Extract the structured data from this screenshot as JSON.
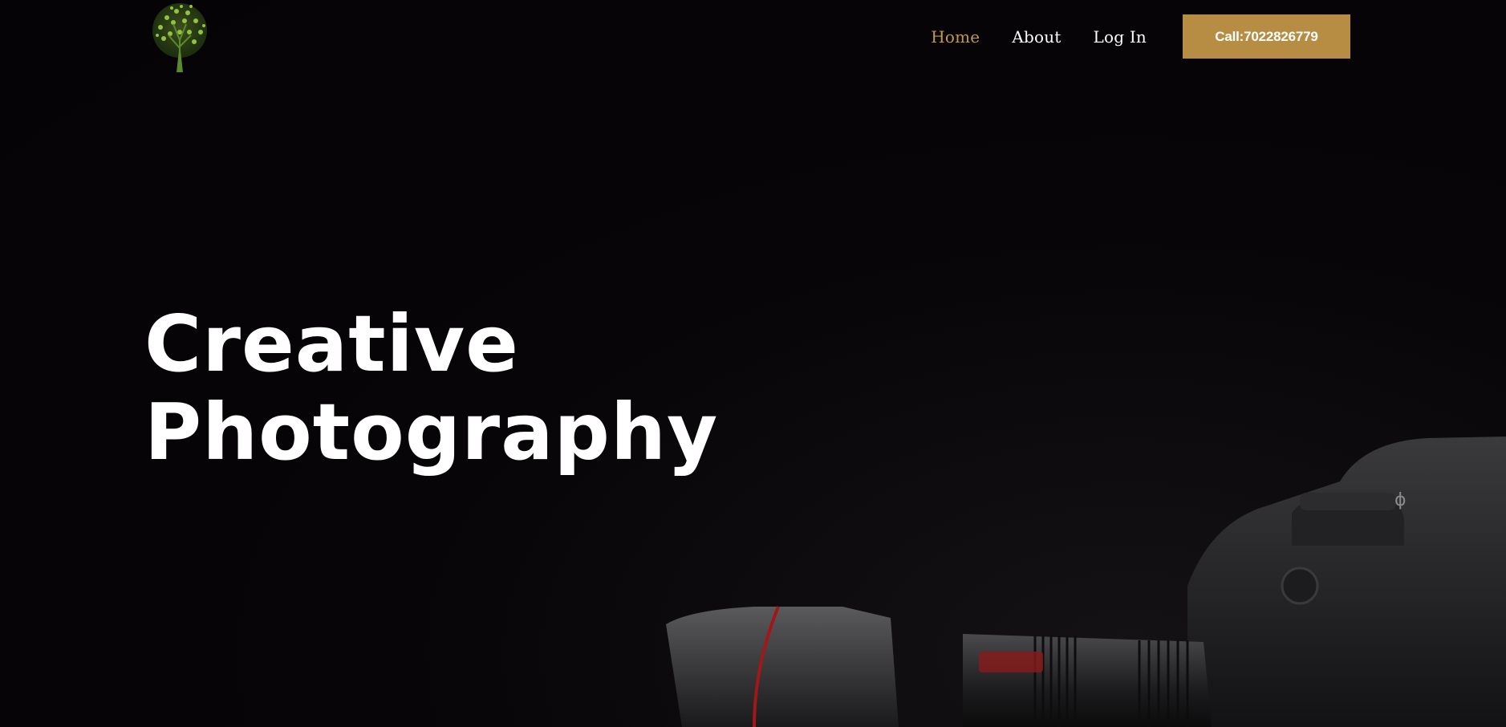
{
  "nav": {
    "items": [
      {
        "label": "Home",
        "active": true
      },
      {
        "label": "About",
        "active": false
      },
      {
        "label": "Log In",
        "active": false
      }
    ],
    "cta_label": "Call:7022826779"
  },
  "hero": {
    "line1": "Creative",
    "line2": "Photography"
  },
  "colors": {
    "background": "#060406",
    "accent": "#b68d42",
    "active_link": "#c19a4b",
    "text": "#ffffff"
  },
  "icons": {
    "logo": "tree-logo-icon"
  }
}
